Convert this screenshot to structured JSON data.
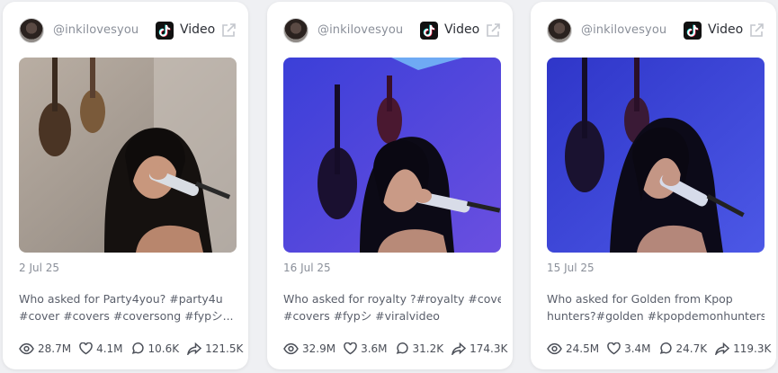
{
  "colors": {
    "background": "#eff0f3",
    "card": "#ffffff",
    "muted_text": "#8a8f99",
    "body_text": "#5a5f6b"
  },
  "cards": [
    {
      "handle": "@inkilovesyou",
      "platform": "Video",
      "platform_icon": "tiktok-icon",
      "date": "2 Jul 25",
      "caption_lines": [
        "Who asked for Party4you? #party4u",
        "#cover #covers #coversong #fypシ..."
      ],
      "stats": {
        "views": "28.7M",
        "likes": "4.1M",
        "comments": "10.6K",
        "shares": "121.5K"
      }
    },
    {
      "handle": "@inkilovesyou",
      "platform": "Video",
      "platform_icon": "tiktok-icon",
      "date": "16 Jul 25",
      "caption_lines": [
        "Who asked for royalty ?#royalty #cover",
        "#covers #fypシ #viralvideo"
      ],
      "stats": {
        "views": "32.9M",
        "likes": "3.6M",
        "comments": "31.2K",
        "shares": "174.3K"
      }
    },
    {
      "handle": "@inkilovesyou",
      "platform": "Video",
      "platform_icon": "tiktok-icon",
      "date": "15 Jul 25",
      "caption_lines": [
        "Who asked for Golden from Kpop",
        "hunters?#golden #kpopdemonhunters..."
      ],
      "stats": {
        "views": "24.5M",
        "likes": "3.4M",
        "comments": "24.7K",
        "shares": "119.3K"
      }
    }
  ]
}
